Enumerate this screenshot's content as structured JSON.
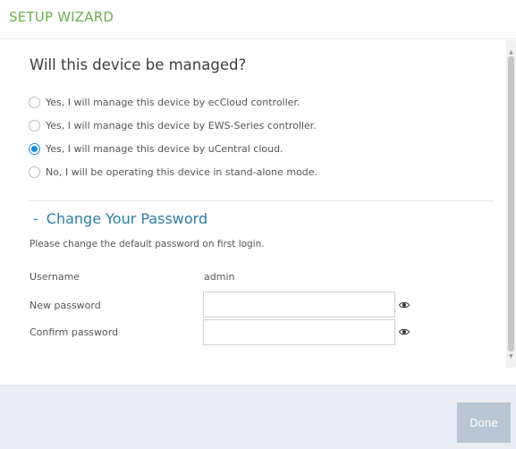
{
  "header": {
    "title": "SETUP WIZARD"
  },
  "question": "Will this device be managed?",
  "management_options": [
    {
      "label": "Yes, I will manage this device by ecCloud controller.",
      "checked": false
    },
    {
      "label": "Yes, I will manage this device by EWS-Series controller.",
      "checked": false
    },
    {
      "label": "Yes, I will manage this device by uCentral cloud.",
      "checked": true
    },
    {
      "label": "No, I will be operating this device in stand-alone mode.",
      "checked": false
    }
  ],
  "password_section": {
    "dash": "-",
    "title": "Change Your Password",
    "note": "Please change the default password on first login.",
    "username_label": "Username",
    "username_value": "admin",
    "new_password_label": "New password",
    "new_password_value": "",
    "confirm_password_label": "Confirm password",
    "confirm_password_value": ""
  },
  "footer": {
    "done_label": "Done"
  },
  "icons": {
    "reveal_password": "eye-icon",
    "scroll_up": "arrow-up-icon",
    "scroll_down": "arrow-down-icon"
  },
  "colors": {
    "title_green": "#6ab04c",
    "section_blue": "#2c7ea6",
    "radio_blue": "#1e88e5",
    "done_button": "#b7c5d5",
    "footer_bg": "#eaedf3"
  }
}
